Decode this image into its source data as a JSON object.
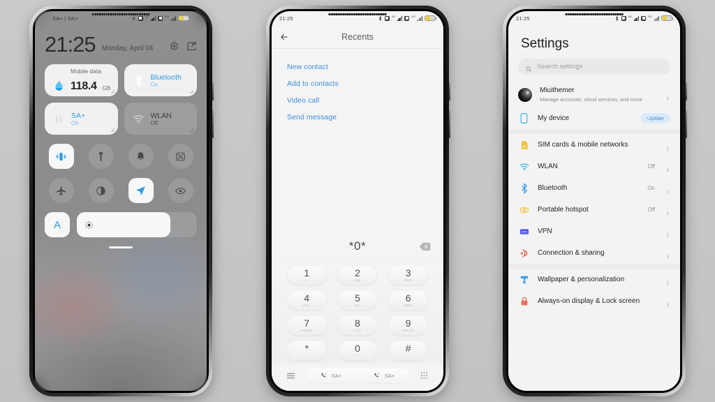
{
  "background_color": "#c9c9c9",
  "phones": {
    "left": {
      "name": "control-center",
      "statusbar": {
        "left_text": "SA+ | SA+",
        "time": "",
        "network_gen": "4G"
      },
      "clock": {
        "time": "21:25",
        "date": "Monday, April 04"
      },
      "header_icons": [
        "settings-gear-icon",
        "edit-icon"
      ],
      "tiles": [
        {
          "title": "Mobile data",
          "value": "118.4",
          "unit": "GB",
          "state": "on",
          "icon": "mobile-data-drop-icon"
        },
        {
          "title": "Bluetooth",
          "sub": "On",
          "state": "on",
          "icon": "bluetooth-icon"
        },
        {
          "title": "SA+",
          "sub": "On",
          "state": "on",
          "icon": "signal-bars-icon"
        },
        {
          "title": "WLAN",
          "sub": "Off",
          "state": "off",
          "icon": "wifi-icon"
        }
      ],
      "toggles_row1": [
        {
          "icon": "vibrate-icon",
          "label": "Vibrate",
          "state": "on"
        },
        {
          "icon": "flashlight-icon",
          "label": "Flashlight",
          "state": "off"
        },
        {
          "icon": "bell-icon",
          "label": "Sound",
          "state": "off"
        },
        {
          "icon": "screenshot-scissors-icon",
          "label": "Screenshot",
          "state": "off"
        }
      ],
      "toggles_row2": [
        {
          "icon": "airplane-icon",
          "label": "Airplane mode",
          "state": "off"
        },
        {
          "icon": "dark-mode-icon",
          "label": "Dark mode",
          "state": "off"
        },
        {
          "icon": "location-arrow-icon",
          "label": "Location",
          "state": "on"
        },
        {
          "icon": "eye-icon",
          "label": "Reading mode",
          "state": "off"
        }
      ],
      "brightness": {
        "auto_label": "A",
        "icon": "brightness-sun-icon",
        "level_percent": 78
      }
    },
    "middle": {
      "name": "dialer-recents",
      "statusbar": {
        "time": "21:25",
        "network_gen": "4G"
      },
      "appbar": {
        "title": "Recents",
        "back_icon": "back-arrow-icon"
      },
      "menu_items": [
        "New contact",
        "Add to contacts",
        "Video call",
        "Send message"
      ],
      "dial_display": {
        "number": "*0*",
        "delete_icon": "backspace-icon"
      },
      "keypad": [
        {
          "num": "1",
          "sub": "∞"
        },
        {
          "num": "2",
          "sub": "ABC"
        },
        {
          "num": "3",
          "sub": "DEF"
        },
        {
          "num": "4",
          "sub": "GHI"
        },
        {
          "num": "5",
          "sub": "JKL"
        },
        {
          "num": "6",
          "sub": "MNO"
        },
        {
          "num": "7",
          "sub": "PQRS"
        },
        {
          "num": "8",
          "sub": "TUV"
        },
        {
          "num": "9",
          "sub": "WXYZ"
        },
        {
          "num": "*",
          "sub": ","
        },
        {
          "num": "0",
          "sub": "+"
        },
        {
          "num": "#",
          "sub": ""
        }
      ],
      "bottom_bar": {
        "menu_icon": "hamburger-menu-icon",
        "call_options": [
          {
            "icon": "call-sim1-icon",
            "label": "SA+"
          },
          {
            "icon": "call-sim2-icon",
            "label": "SA+"
          }
        ],
        "keypad_icon": "dialpad-grid-icon"
      }
    },
    "right": {
      "name": "settings",
      "statusbar": {
        "time": "21:25",
        "network_gen": "4G"
      },
      "title": "Settings",
      "search": {
        "placeholder": "Search settings",
        "icon": "search-icon"
      },
      "account": {
        "name": "Miuithemer",
        "subtitle": "Manage accounts, cloud services, and more",
        "icon": "avatar"
      },
      "device": {
        "label": "My device",
        "badge": "Update",
        "icon": "phone-outline-icon"
      },
      "group_network": [
        {
          "label": "SIM cards & mobile networks",
          "value": "",
          "icon": "sim-card-icon",
          "color": "#f5bf3f"
        },
        {
          "label": "WLAN",
          "value": "Off",
          "icon": "wifi-icon",
          "color": "#3fb8e8"
        },
        {
          "label": "Bluetooth",
          "value": "On",
          "icon": "bluetooth-icon",
          "color": "#3f9de8"
        },
        {
          "label": "Portable hotspot",
          "value": "Off",
          "icon": "hotspot-icon",
          "color": "#f2c44a"
        },
        {
          "label": "VPN",
          "value": "",
          "icon": "vpn-badge-icon",
          "color": "#4a57e0"
        },
        {
          "label": "Connection & sharing",
          "value": "",
          "icon": "connection-share-icon",
          "color": "#e8594a"
        }
      ],
      "group_personalization": [
        {
          "label": "Wallpaper & personalization",
          "value": "",
          "icon": "wallpaper-brush-icon",
          "color": "#3f9de8"
        },
        {
          "label": "Always-on display & Lock screen",
          "value": "",
          "icon": "lock-icon",
          "color": "#e8705a"
        }
      ]
    }
  }
}
